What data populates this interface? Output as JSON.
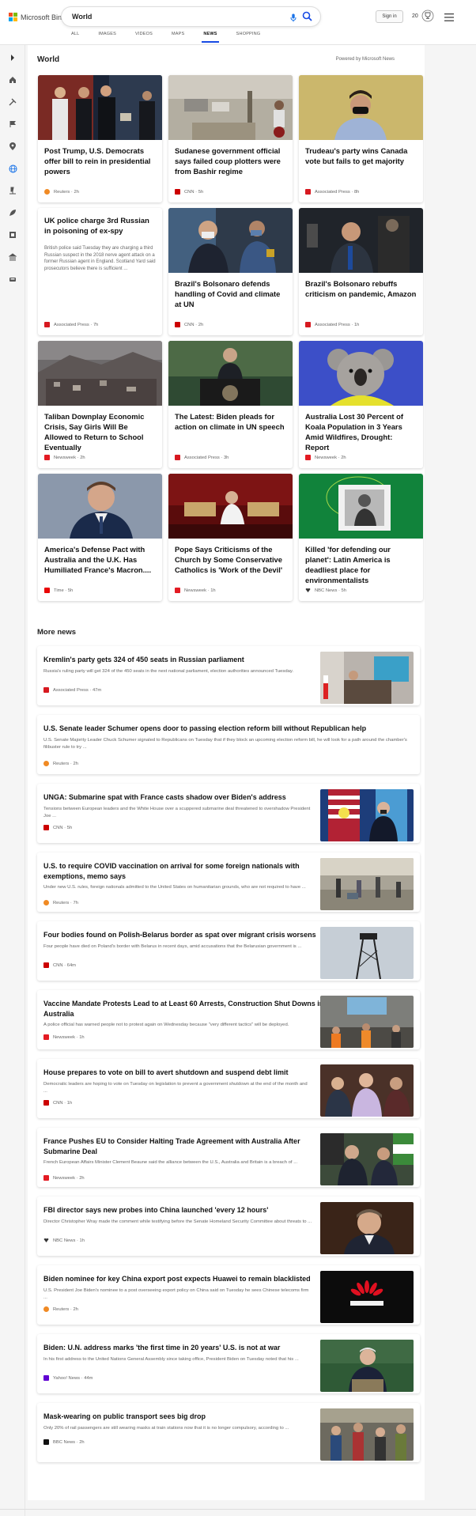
{
  "header": {
    "brand": "Microsoft Bing",
    "search_value": "World",
    "sign_in": "Sign in",
    "rewards_count": "20",
    "tabs": [
      {
        "label": "ALL"
      },
      {
        "label": "IMAGES"
      },
      {
        "label": "VIDEOS"
      },
      {
        "label": "MAPS"
      },
      {
        "label": "NEWS"
      },
      {
        "label": "SHOPPING"
      }
    ],
    "active_tab": "NEWS"
  },
  "section": {
    "title": "World",
    "powered_by": "Powered by Microsoft News"
  },
  "cards": [
    {
      "title": "Post Trump, U.S. Democrats offer bill to rein in presidential powers",
      "source": "Reuters",
      "age": "2h",
      "icon": "reuters-icon"
    },
    {
      "title": "Sudanese government official says failed coup plotters were from Bashir regime",
      "source": "CNN",
      "age": "5h",
      "icon": "cnn-icon"
    },
    {
      "title": "Trudeau's party wins Canada vote but fails to get majority",
      "source": "Associated Press",
      "age": "8h",
      "icon": "ap-icon"
    },
    {
      "title": "UK police charge 3rd Russian in poisoning of ex-spy",
      "desc": "British police said Tuesday they are charging a third Russian suspect in the 2018 nerve agent attack on a former Russian agent in England. Scotland Yard said prosecutors believe there is sufficient ...",
      "source": "Associated Press",
      "age": "7h",
      "icon": "ap-icon"
    },
    {
      "title": "Brazil's Bolsonaro defends handling of Covid and climate at UN",
      "source": "CNN",
      "age": "2h",
      "icon": "cnn-icon"
    },
    {
      "title": "Brazil's Bolsonaro rebuffs criticism on pandemic, Amazon",
      "source": "Associated Press",
      "age": "1h",
      "icon": "ap-icon"
    },
    {
      "title": "Taliban Downplay Economic Crisis, Say Girls Will Be Allowed to Return to School Eventually",
      "source": "Newsweek",
      "age": "2h",
      "icon": "newsweek-icon"
    },
    {
      "title": "The Latest: Biden pleads for action on climate in UN speech",
      "source": "Associated Press",
      "age": "3h",
      "icon": "ap-icon"
    },
    {
      "title": "Australia Lost 30 Percent of Koala Population in 3 Years Amid Wildfires, Drought: Report",
      "source": "Newsweek",
      "age": "2h",
      "icon": "newsweek-icon"
    },
    {
      "title": "America's Defense Pact with Australia and the U.K. Has Humiliated France's Macron....",
      "source": "Time",
      "age": "5h",
      "icon": "time-icon"
    },
    {
      "title": "Pope Says Criticisms of the Church by Some Conservative Catholics is 'Work of the Devil'",
      "source": "Newsweek",
      "age": "1h",
      "icon": "newsweek-icon"
    },
    {
      "title": "Killed 'for defending our planet': Latin America is deadliest place for environmentalists",
      "source": "NBC News",
      "age": "5h",
      "icon": "nbc-icon"
    }
  ],
  "more_news": {
    "title": "More news",
    "items": [
      {
        "title": "Kremlin's party gets 324 of 450 seats in Russian parliament",
        "desc": "Russia's ruling party will get 324 of the 450 seats in the next national parliament, election authorities announced Tuesday.",
        "source": "Associated Press",
        "age": "47m",
        "icon": "ap-icon"
      },
      {
        "title": "U.S. Senate leader Schumer opens door to passing election reform bill without Republican help",
        "desc": "U.S. Senate Majority Leader Chuck Schumer signaled to Republicans on Tuesday that if they block an upcoming election reform bill, he will look for a path around the chamber's filibuster rule to try ...",
        "source": "Reuters",
        "age": "2h",
        "icon": "reuters-icon"
      },
      {
        "title": "UNGA: Submarine spat with France casts shadow over Biden's address",
        "desc": "Tensions between European leaders and the White House over a scuppered submarine deal threatened to overshadow President Joe ...",
        "source": "CNN",
        "age": "5h",
        "icon": "cnn-icon"
      },
      {
        "title": "U.S. to require COVID vaccination on arrival for some foreign nationals with exemptions, memo says",
        "desc": "Under new U.S. rules, foreign nationals admitted to the United States on humanitarian grounds, who are not required to have ...",
        "source": "Reuters",
        "age": "7h",
        "icon": "reuters-icon"
      },
      {
        "title": "Four bodies found on Polish-Belarus border as spat over migrant crisis worsens",
        "desc": "Four people have died on Poland's border with Belarus in recent days, amid accusations that the Belarusian government is ...",
        "source": "CNN",
        "age": "64m",
        "icon": "cnn-icon"
      },
      {
        "title": "Vaccine Mandate Protests Lead to at Least 60 Arrests, Construction Shut Downs in Australia",
        "desc": "A police official has warned people not to protest again on Wednesday because \"very different tactics\" will be deployed.",
        "source": "Newsweek",
        "age": "1h",
        "icon": "newsweek-icon"
      },
      {
        "title": "House prepares to vote on bill to avert shutdown and suspend debt limit",
        "desc": "Democratic leaders are hoping to vote on Tuesday on legislation to prevent a government shutdown at the end of the month and ...",
        "source": "CNN",
        "age": "1h",
        "icon": "cnn-icon"
      },
      {
        "title": "France Pushes EU to Consider Halting Trade Agreement with Australia After Submarine Deal",
        "desc": "French European Affairs Minister Clement Beaune said the alliance between the U.S., Australia and Britain is a breach of ...",
        "source": "Newsweek",
        "age": "2h",
        "icon": "newsweek-icon"
      },
      {
        "title": "FBI director says new probes into China launched 'every 12 hours'",
        "desc": "Director Christopher Wray made the comment while testifying before the Senate Homeland Security Committee about threats to ...",
        "source": "NBC News",
        "age": "1h",
        "icon": "nbc-icon"
      },
      {
        "title": "Biden nominee for key China export post expects Huawei to remain blacklisted",
        "desc": "U.S. President Joe Biden's nominee to a post overseeing export policy on China said on Tuesday he sees Chinese telecoms firm ...",
        "source": "Reuters",
        "age": "2h",
        "icon": "reuters-icon"
      },
      {
        "title": "Biden: U.N. address marks 'the first time in 20 years' U.S. is not at war",
        "desc": "In his first address to the United Nations General Assembly since taking office, President Biden on Tuesday noted that his ...",
        "source": "Yahoo! News",
        "age": "44m",
        "icon": "yahoo-icon"
      },
      {
        "title": "Mask-wearing on public transport sees big drop",
        "desc": "Only 20% of rail passengers are still wearing masks at train stations now that it is no longer compulsory, according to ...",
        "source": "BBC News",
        "age": "2h",
        "icon": "bbc-icon"
      }
    ]
  },
  "colors": {
    "accent": "#174ae4",
    "reuters": "#f08a24",
    "cnn": "#cc0000",
    "ap": "#d71920",
    "newsweek": "#e31b23",
    "time": "#e90606",
    "yahoo": "#6001d2",
    "bbc": "#111111"
  }
}
